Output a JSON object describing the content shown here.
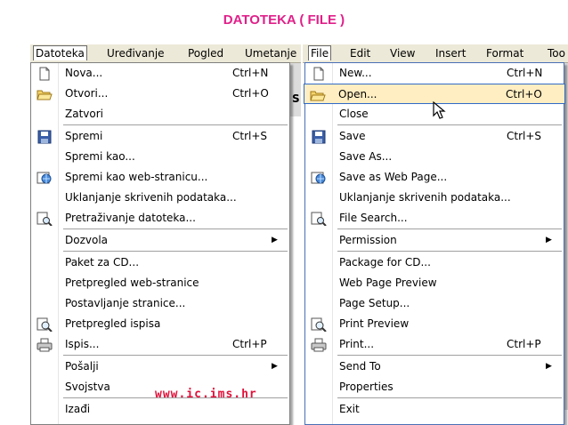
{
  "title": "DATOTEKA ( FILE )",
  "watermark": "www.ic.ims.hr",
  "colors": {
    "title": "#e0208a",
    "watermark": "#e0103a",
    "selection": "#ffeec2",
    "selection_border": "#316ac5",
    "menubar": "#ece9d8"
  },
  "left": {
    "menubar": [
      "Datoteka",
      "Uređivanje",
      "Pogled",
      "Umetanje"
    ],
    "peek": "S",
    "items": [
      {
        "icon": "new-document-icon",
        "label": "Nova...",
        "shortcut": "Ctrl+N"
      },
      {
        "icon": "open-folder-icon",
        "label": "Otvori...",
        "shortcut": "Ctrl+O"
      },
      {
        "icon": "",
        "label": "Zatvori",
        "shortcut": ""
      },
      {
        "icon": "save-icon",
        "label": "Spremi",
        "shortcut": "Ctrl+S"
      },
      {
        "icon": "",
        "label": "Spremi kao...",
        "shortcut": ""
      },
      {
        "icon": "web-page-icon",
        "label": "Spremi kao web-stranicu...",
        "shortcut": ""
      },
      {
        "icon": "",
        "label": "Uklanjanje skrivenih podataka...",
        "shortcut": ""
      },
      {
        "icon": "search-files-icon",
        "label": "Pretraživanje datoteka...",
        "shortcut": ""
      },
      {
        "icon": "",
        "label": "Dozvola",
        "shortcut": "",
        "submenu": true
      },
      {
        "icon": "",
        "label": "Paket za CD...",
        "shortcut": ""
      },
      {
        "icon": "",
        "label": "Pretpregled web-stranice",
        "shortcut": ""
      },
      {
        "icon": "",
        "label": "Postavljanje stranice...",
        "shortcut": ""
      },
      {
        "icon": "print-preview-icon",
        "label": "Pretpregled ispisa",
        "shortcut": ""
      },
      {
        "icon": "print-icon",
        "label": "Ispis...",
        "shortcut": "Ctrl+P"
      },
      {
        "icon": "",
        "label": "Pošalji",
        "shortcut": "",
        "submenu": true
      },
      {
        "icon": "",
        "label": "Svojstva",
        "shortcut": ""
      },
      {
        "icon": "",
        "label": "Izađi",
        "shortcut": ""
      }
    ]
  },
  "right": {
    "menubar": [
      "File",
      "Edit",
      "View",
      "Insert",
      "Format",
      "Too"
    ],
    "items": [
      {
        "icon": "new-document-icon",
        "label": "New...",
        "shortcut": "Ctrl+N"
      },
      {
        "icon": "open-folder-icon",
        "label": "Open...",
        "shortcut": "Ctrl+O",
        "selected": true
      },
      {
        "icon": "",
        "label": "Close",
        "shortcut": ""
      },
      {
        "icon": "save-icon",
        "label": "Save",
        "shortcut": "Ctrl+S"
      },
      {
        "icon": "",
        "label": "Save As...",
        "shortcut": ""
      },
      {
        "icon": "web-page-icon",
        "label": "Save as Web Page...",
        "shortcut": ""
      },
      {
        "icon": "",
        "label": "Uklanjanje skrivenih podataka...",
        "shortcut": ""
      },
      {
        "icon": "search-files-icon",
        "label": "File Search...",
        "shortcut": ""
      },
      {
        "icon": "",
        "label": "Permission",
        "shortcut": "",
        "submenu": true
      },
      {
        "icon": "",
        "label": "Package for CD...",
        "shortcut": ""
      },
      {
        "icon": "",
        "label": "Web Page Preview",
        "shortcut": ""
      },
      {
        "icon": "",
        "label": "Page Setup...",
        "shortcut": ""
      },
      {
        "icon": "print-preview-icon",
        "label": "Print Preview",
        "shortcut": ""
      },
      {
        "icon": "print-icon",
        "label": "Print...",
        "shortcut": "Ctrl+P"
      },
      {
        "icon": "",
        "label": "Send To",
        "shortcut": "",
        "submenu": true
      },
      {
        "icon": "",
        "label": "Properties",
        "shortcut": ""
      },
      {
        "icon": "",
        "label": "Exit",
        "shortcut": ""
      }
    ]
  }
}
